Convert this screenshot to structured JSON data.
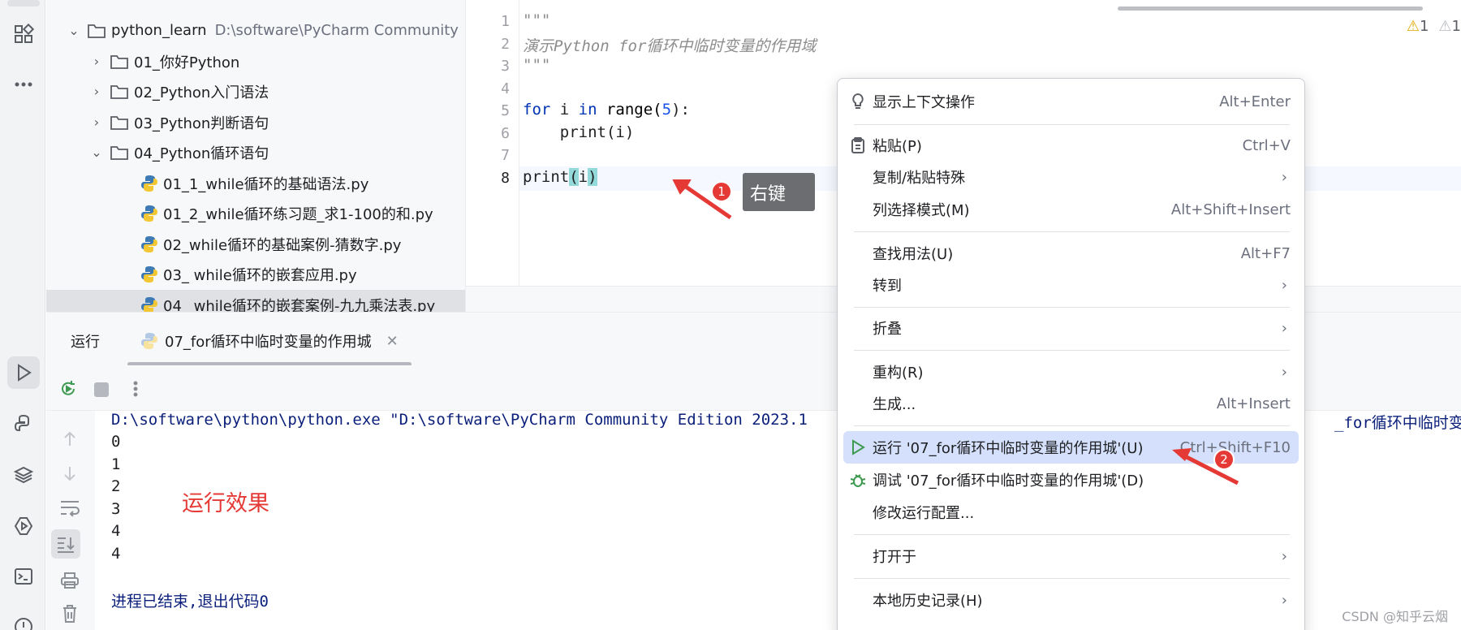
{
  "project_tree": {
    "root_name": "python_learn",
    "root_path": "D:\\software\\PyCharm Community",
    "folders": [
      {
        "label": "01_你好Python"
      },
      {
        "label": "02_Python入门语法"
      },
      {
        "label": "03_Python判断语句"
      },
      {
        "label": "04_Python循环语句"
      }
    ],
    "files": [
      {
        "label": "01_1_while循环的基础语法.py"
      },
      {
        "label": "01_2_while循环练习题_求1-100的和.py"
      },
      {
        "label": "02_while循环的基础案例-猜数字.py"
      },
      {
        "label": "03_ while循环的嵌套应用.py"
      },
      {
        "label": "04_ while循环的嵌套案例-九九乘法表.py"
      }
    ]
  },
  "editor": {
    "line_numbers": [
      "1",
      "2",
      "3",
      "4",
      "5",
      "6",
      "7",
      "8"
    ],
    "code": {
      "l1": "\"\"\"",
      "l2": "演示Python for循环中临时变量的作用域",
      "l3": "\"\"\"",
      "l5_kw1": "for",
      "l5_var": " i ",
      "l5_kw2": "in",
      "l5_fn": " range(",
      "l5_num": "5",
      "l5_end": "):",
      "l6": "    print(i)",
      "l8_fn": "print",
      "l8_open": "(",
      "l8_arg": "i",
      "l8_close": ")"
    },
    "warnings_a": "1",
    "warnings_b": "1"
  },
  "annotations": {
    "tooltip_right_click": "右键",
    "badge_1": "1",
    "badge_2": "2",
    "run_effect": "运行效果",
    "arrow_color": "#e53935"
  },
  "run_panel": {
    "title": "运行",
    "tab_label": "07_for循环中临时变量的作用城",
    "console_command": "D:\\software\\python\\python.exe \"D:\\software\\PyCharm Community Edition 2023.1",
    "console_command_tail": "_for循环中临时变量",
    "output": [
      "0",
      "1",
      "2",
      "3",
      "4",
      "4"
    ],
    "exit_message": "进程已结束,退出代码0"
  },
  "context_menu": {
    "items": [
      {
        "label": "显示上下文操作",
        "shortcut": "Alt+Enter"
      },
      {
        "label": "粘贴(P)",
        "shortcut": "Ctrl+V"
      },
      {
        "label": "复制/粘贴特殊",
        "shortcut": ""
      },
      {
        "label": "列选择模式(M)",
        "shortcut": "Alt+Shift+Insert"
      },
      {
        "label": "查找用法(U)",
        "shortcut": "Alt+F7"
      },
      {
        "label": "转到",
        "shortcut": ""
      },
      {
        "label": "折叠",
        "shortcut": ""
      },
      {
        "label": "重构(R)",
        "shortcut": ""
      },
      {
        "label": "生成...",
        "shortcut": "Alt+Insert"
      },
      {
        "label": "运行 '07_for循环中临时变量的作用城'(U)",
        "shortcut": "Ctrl+Shift+F10"
      },
      {
        "label": "调试 '07_for循环中临时变量的作用城'(D)",
        "shortcut": ""
      },
      {
        "label": "修改运行配置...",
        "shortcut": ""
      },
      {
        "label": "打开于",
        "shortcut": ""
      },
      {
        "label": "本地历史记录(H)",
        "shortcut": ""
      }
    ],
    "highlight_color": "#d5e1fc",
    "run_icon_color": "#3d9a50"
  },
  "watermark": "CSDN @知乎云烟"
}
